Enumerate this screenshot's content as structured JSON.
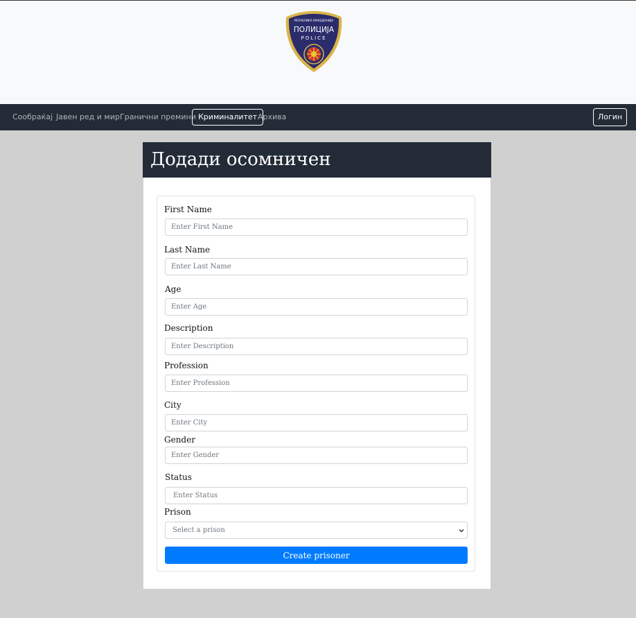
{
  "nav": {
    "items": [
      "Сообраќај",
      "Јавен ред и мир",
      "Гранични премини",
      "Криминалитет",
      "Архива"
    ],
    "active_index": 3,
    "login_label": "Логин"
  },
  "logo": {
    "line1": "РЕПУБЛИКА МАКЕДОНИЈА",
    "line2": "ПОЛИЦИЈА",
    "line3": "POLICE"
  },
  "page": {
    "title": "Додади осомничен"
  },
  "form": {
    "fields": [
      {
        "label": "First Name",
        "placeholder": "Enter First Name"
      },
      {
        "label": "Last Name",
        "placeholder": "Enter Last Name"
      },
      {
        "label": "Age",
        "placeholder": "Enter Age"
      },
      {
        "label": "Description",
        "placeholder": "Enter Description"
      },
      {
        "label": "Profession",
        "placeholder": "Enter Profession"
      },
      {
        "label": "City",
        "placeholder": "Enter City"
      },
      {
        "label": "Gender",
        "placeholder": "Enter Gender"
      },
      {
        "label": "Status",
        "placeholder": "Enter Status"
      }
    ],
    "prison": {
      "label": "Prison",
      "selected": "Select a prison"
    },
    "submit_label": "Create prisoner"
  },
  "colors": {
    "navbar": "#232b37",
    "primary": "#007bff",
    "badge_blue": "#2b2c6b",
    "badge_gold": "#d9b44a"
  }
}
